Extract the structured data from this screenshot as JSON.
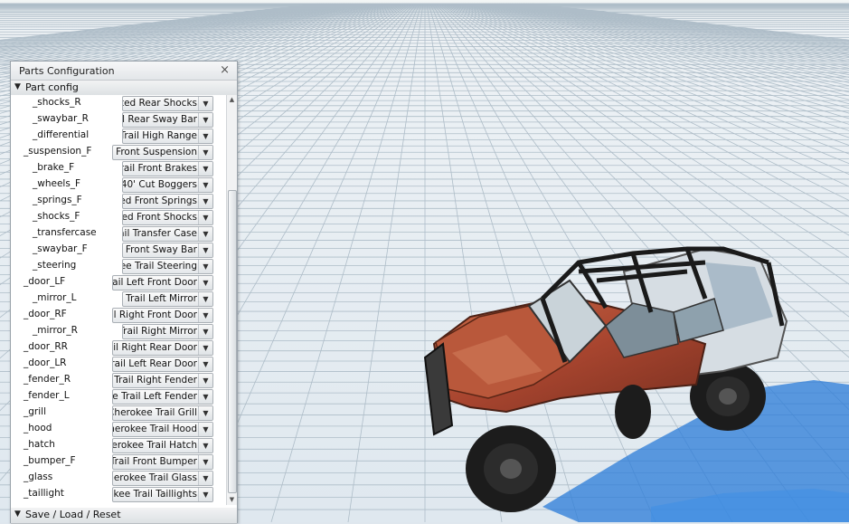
{
  "window": {
    "title": "Parts Configuration",
    "close": "×"
  },
  "sections": {
    "part_config": "Part config",
    "save_load": "Save / Load / Reset"
  },
  "icons": {
    "expand": "▼",
    "dropdown": "▼",
    "scroll_up": "▲",
    "scroll_down": "▼"
  },
  "parts": [
    {
      "name": "_shocks_R",
      "value": "ted Rear Shocks"
    },
    {
      "name": "_swaybar_R",
      "value": "l Rear Sway Bar"
    },
    {
      "name": "_differential",
      "value": "Trail High Range"
    },
    {
      "name": "_suspension_F",
      "value": "Front Suspension"
    },
    {
      "name": "_brake_F",
      "value": "rail Front Brakes"
    },
    {
      "name": "_wheels_F",
      "value": "40' Cut Boggers"
    },
    {
      "name": "_springs_F",
      "value": "ed Front Springs"
    },
    {
      "name": "_shocks_F",
      "value": "ed Front Shocks"
    },
    {
      "name": "_transfercase",
      "value": "ail Transfer Case"
    },
    {
      "name": "_swaybar_F",
      "value": "Front Sway Bar"
    },
    {
      "name": "_steering",
      "value": "ee Trail Steering"
    },
    {
      "name": "_door_LF",
      "value": "rail Left Front Door"
    },
    {
      "name": "_mirror_L",
      "value": "e Trail Left Mirror"
    },
    {
      "name": "_door_RF",
      "value": "ail Right Front Door"
    },
    {
      "name": "_mirror_R",
      "value": "Trail Right Mirror"
    },
    {
      "name": "_door_RR",
      "value": "ail Right Rear Door"
    },
    {
      "name": "_door_LR",
      "value": "rail Left Rear Door"
    },
    {
      "name": "_fender_R",
      "value": "e Trail Right Fender"
    },
    {
      "name": "_fender_L",
      "value": "e Trail Left Fender"
    },
    {
      "name": "_grill",
      "value": "Cherokee Trail Grill"
    },
    {
      "name": "_hood",
      "value": "herokee Trail Hood"
    },
    {
      "name": "_hatch",
      "value": "herokee Trail Hatch"
    },
    {
      "name": "_bumper_F",
      "value": "Trail Front Bumper"
    },
    {
      "name": "_glass",
      "value": "herokee Trail Glass"
    },
    {
      "name": "_taillight",
      "value": "okee Trail Taillights"
    }
  ]
}
